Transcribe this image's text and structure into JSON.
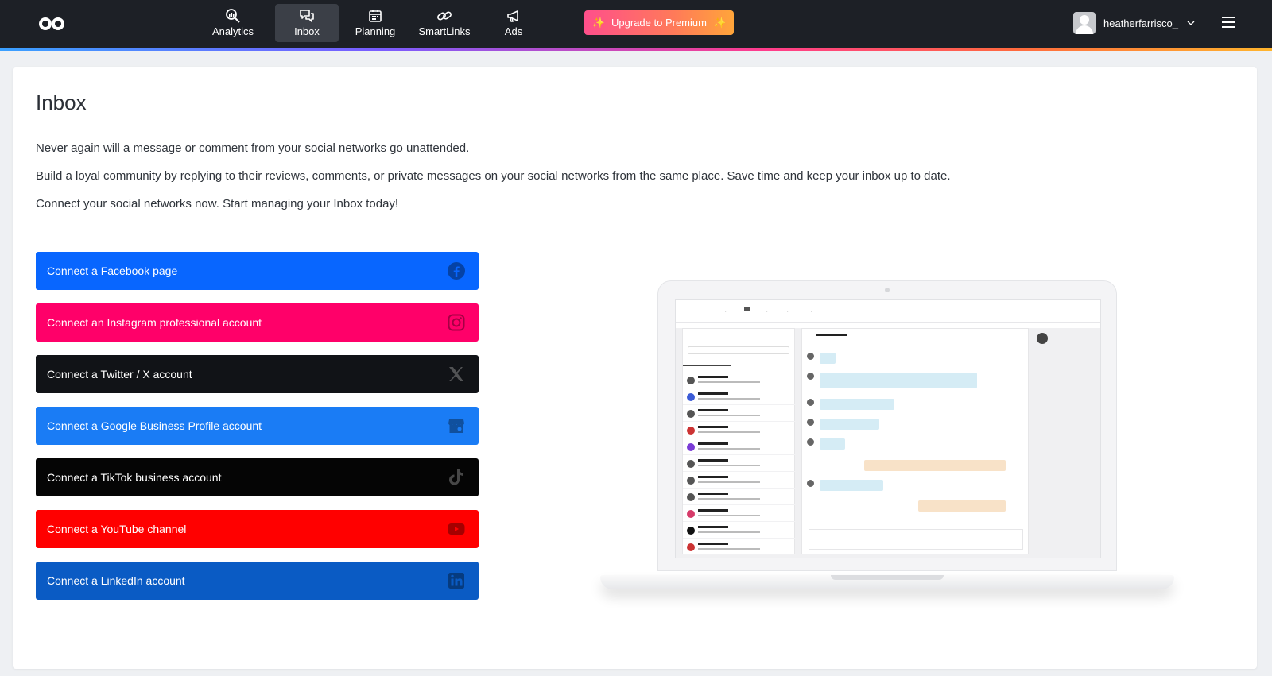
{
  "nav": {
    "items": [
      {
        "label": "Analytics",
        "icon": "analytics-icon",
        "active": false
      },
      {
        "label": "Inbox",
        "icon": "inbox-icon",
        "active": true
      },
      {
        "label": "Planning",
        "icon": "calendar-icon",
        "active": false
      },
      {
        "label": "SmartLinks",
        "icon": "link-icon",
        "active": false
      },
      {
        "label": "Ads",
        "icon": "megaphone-icon",
        "active": false
      }
    ],
    "upgrade_label": "Upgrade to Premium",
    "username": "heatherfarrisco_"
  },
  "page": {
    "title": "Inbox",
    "paragraphs": [
      "Never again will a message or comment from your social networks go unattended.",
      "Build a loyal community by replying to their reviews, comments, or private messages on your social networks from the same place. Save time and keep your inbox up to date.",
      "Connect your social networks now. Start managing your Inbox today!"
    ]
  },
  "connect_buttons": [
    {
      "label": "Connect a Facebook page",
      "color": "#0866ff",
      "icon": "facebook-icon"
    },
    {
      "label": "Connect an Instagram professional account",
      "color": "#ff0069",
      "icon": "instagram-icon"
    },
    {
      "label": "Connect a Twitter / X account",
      "color": "#111317",
      "icon": "x-icon"
    },
    {
      "label": "Connect a Google Business Profile account",
      "color": "#1a7cf5",
      "icon": "google-business-icon"
    },
    {
      "label": "Connect a TikTok business account",
      "color": "#050505",
      "icon": "tiktok-icon"
    },
    {
      "label": "Connect a YouTube channel",
      "color": "#ff0000",
      "icon": "youtube-icon"
    },
    {
      "label": "Connect a LinkedIn account",
      "color": "#0a5bc4",
      "icon": "linkedin-icon"
    }
  ]
}
